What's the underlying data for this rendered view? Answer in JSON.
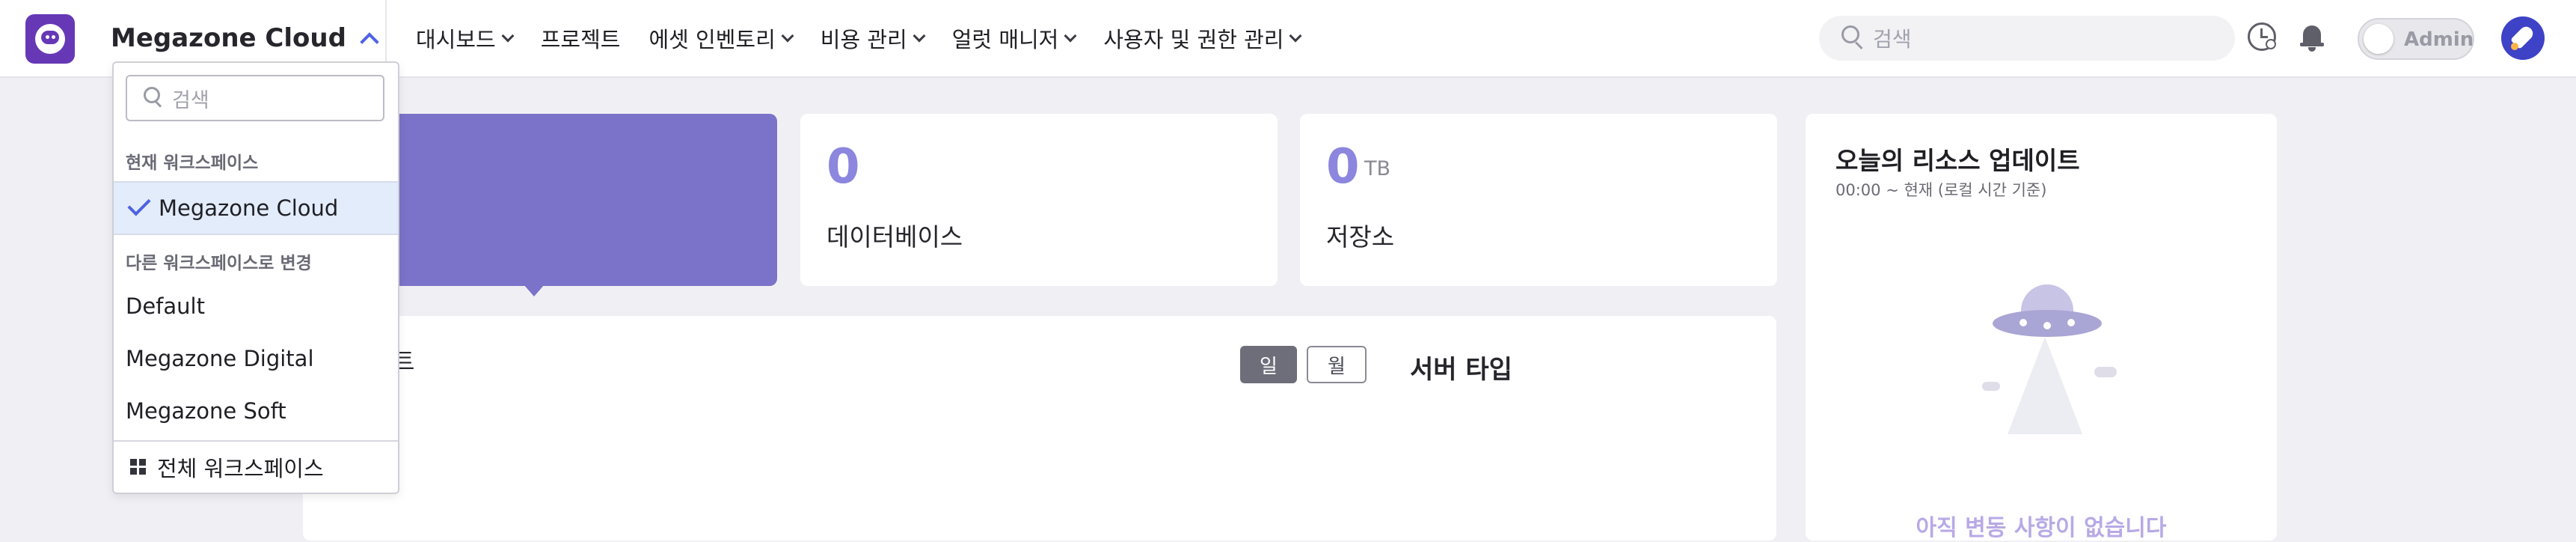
{
  "header": {
    "workspace_name": "Megazone Cloud",
    "nav": [
      {
        "label": "대시보드",
        "has_dropdown": true
      },
      {
        "label": "프로젝트",
        "has_dropdown": false
      },
      {
        "label": "에셋 인벤토리",
        "has_dropdown": true
      },
      {
        "label": "비용 관리",
        "has_dropdown": true
      },
      {
        "label": "얼럿 매니저",
        "has_dropdown": true
      },
      {
        "label": "사용자 및 권한 관리",
        "has_dropdown": true
      }
    ],
    "search_placeholder": "검색",
    "admin_toggle_label": "Admin",
    "admin_toggle_on": false
  },
  "workspace_dropdown": {
    "search_placeholder": "검색",
    "current_section_label": "현재 워크스페이스",
    "current_workspace": "Megazone Cloud",
    "other_section_label": "다른 워크스페이스로 변경",
    "other_workspaces": [
      "Default",
      "Megazone Digital",
      "Megazone Soft"
    ],
    "all_workspaces_label": "전체 워크스페이스"
  },
  "summary_cards": {
    "database": {
      "value": "0",
      "label": "데이터베이스"
    },
    "storage": {
      "value": "0",
      "unit": "TB",
      "label": "저장소"
    }
  },
  "main_panel": {
    "title_fragment": "트",
    "period_day": "일",
    "period_month": "월",
    "selected_period": "일",
    "server_type_title": "서버 타입"
  },
  "resource_update": {
    "title": "오늘의 리소스 업데이트",
    "subtitle": "00:00 ~ 현재 (로컬 시간 기준)",
    "empty_message": "아직 변동 사항이 없습니다"
  },
  "colors": {
    "accent": "#4f63e6",
    "card_purple": "#7b72c9",
    "number_purple": "#8c86de",
    "selected_row_bg": "#e3ecfb"
  }
}
